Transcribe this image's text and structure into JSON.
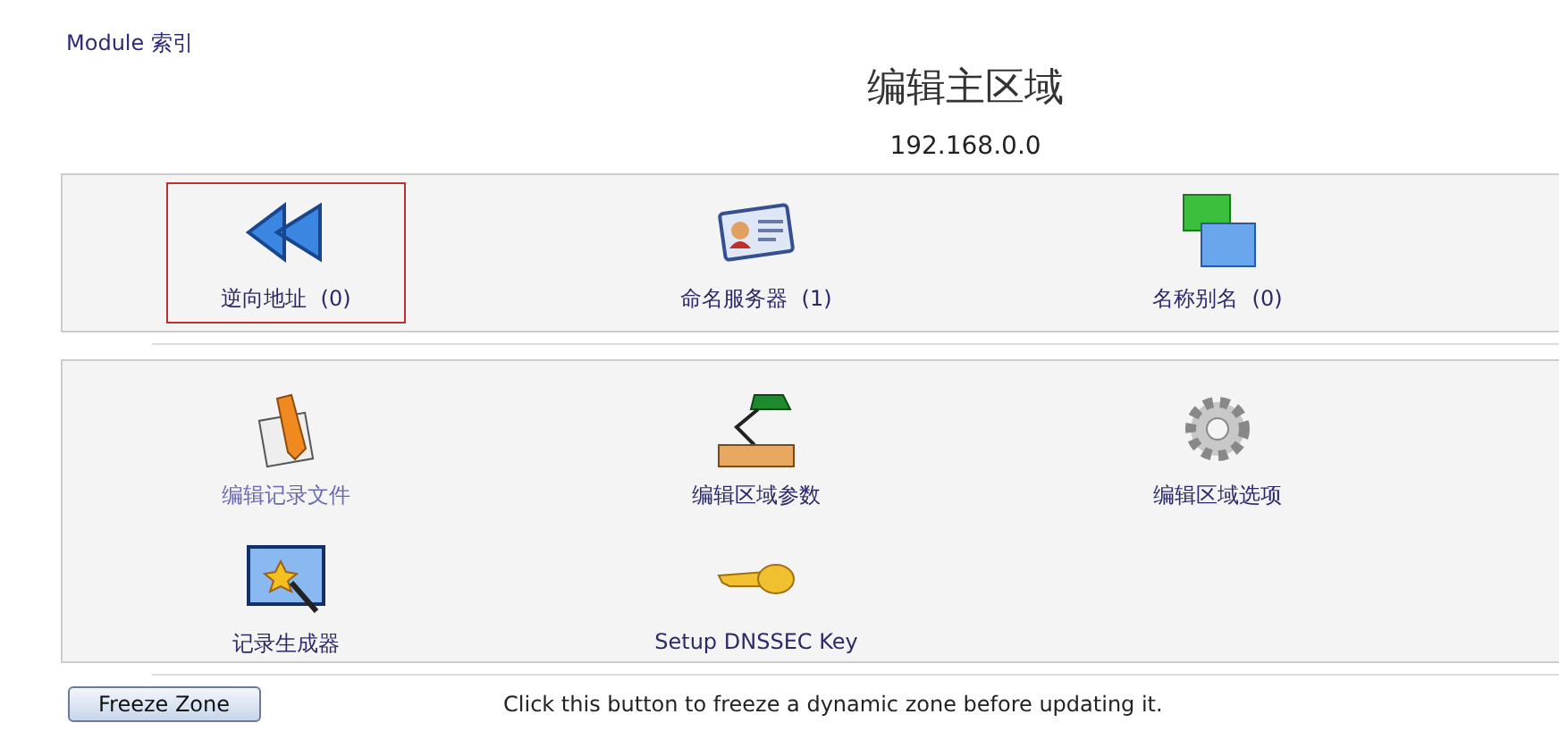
{
  "index_link": "Module 索引",
  "title": "编辑主区域",
  "subtitle": "192.168.0.0",
  "panels": [
    {
      "items": [
        {
          "kind": "reverse",
          "label": "逆向地址",
          "count": "(0)",
          "selected": true,
          "visited": false
        },
        {
          "kind": "nameserver",
          "label": "命名服务器",
          "count": "(1)",
          "selected": false,
          "visited": false
        },
        {
          "kind": "alias",
          "label": "名称别名",
          "count": "(0)",
          "selected": false,
          "visited": false
        }
      ]
    },
    {
      "items": [
        {
          "kind": "edit",
          "label": "编辑记录文件",
          "selected": false,
          "visited": true
        },
        {
          "kind": "lamp",
          "label": "编辑区域参数",
          "selected": false,
          "visited": false
        },
        {
          "kind": "gear",
          "label": "编辑区域选项",
          "selected": false,
          "visited": false
        },
        {
          "kind": "wizard",
          "label": "记录生成器",
          "selected": false,
          "visited": false
        },
        {
          "kind": "key",
          "label": "Setup DNSSEC Key",
          "selected": false,
          "visited": false
        }
      ]
    }
  ],
  "freeze": {
    "button": "Freeze Zone",
    "note": "Click this button to freeze a dynamic zone before updating it."
  }
}
